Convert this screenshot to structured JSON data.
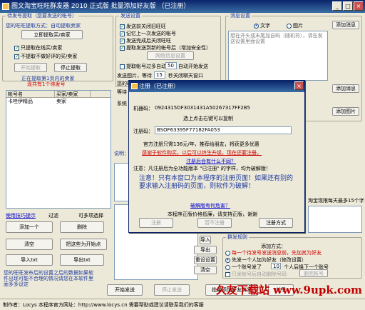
{
  "window": {
    "title": "图文淘宝旺旺群发器 2010 正式版 批量添加好友版 （已注册）",
    "minimize": "_",
    "maximize": "□",
    "close": "×"
  },
  "left_panel": {
    "group_title": "待发号提取（您要发送的帐号）",
    "hint": "您的旺旺提取方式：自动提取卖家",
    "btn_extract_now": "立即提取买/卖家",
    "chk_online_only": "只提取在线买/卖家",
    "chk_skip_sent": "不提取不做好评的买/卖家",
    "btn_start_extract": "开始提取",
    "btn_stop_extract": "停止提取",
    "status1": "正在提取第1页内的卖家",
    "status2": "现共有1个待发号",
    "table_headers": [
      "帐号名",
      "买家/卖家"
    ],
    "table_rows": [
      [
        "卡哇伊精品",
        "卖家"
      ]
    ],
    "link_tips": "使用技巧提示",
    "lbl_filter": "过滤",
    "lbl_select": "可多项选择",
    "btn_add_one": "添加一个",
    "btn_delete": "删除",
    "btn_clear": "清空",
    "btn_resend": "把这些为开始点",
    "btn_import": "导入txt",
    "btn_export": "导出txt",
    "note": "您的旺旺发布后的设置之后的数据如果软件出现可能不合理的情况请您在本软件里面多多设定"
  },
  "send_settings": {
    "group_title": "发送设置",
    "chk1": "发送前关闭旧旺旺",
    "chk2": "记忆上一次发送的帐号",
    "chk3": "发送完成后关闭旺旺",
    "chk4": "提取发送到新的帐号后（增加安全性）",
    "btn_network": "网络信息设置",
    "chk5": "提取帐号过多自动",
    "chk5_value": "50",
    "chk5_tail": "自动开始发送",
    "lbl_image": "发送图片，等待",
    "image_wait": "15",
    "image_tail": "秒关闭聊天窗口",
    "lbl_cut": "您的旺旺联系多少",
    "lbl_wait": "等待",
    "lbl_status": "系统",
    "lbl_desc": "说明："
  },
  "message_panel": {
    "group_title": "消息设置",
    "radio_text": "文字",
    "radio_image": "图片",
    "btn_add_msg": "添加消息",
    "placeholder": "想在开头或末尾加自码（随机符），请在发送设置里面设置",
    "btn_add_msg2": "添加消息",
    "btn_add_msg3": "添加图片",
    "lbl_limit": "淘宝现限每天最多15个字"
  },
  "mass_panel": {
    "btn_import": "导入",
    "btn_export": "导出",
    "btn_reset": "重设设置",
    "btn_clear": "清空",
    "group_title": "群发规则",
    "lbl_add_mode": "添加方式：",
    "opt1": "每一个待发号发送消息前，先加其为好友",
    "opt2": "先发一个人加为好友（修改设置）",
    "opt3": "一个账号发了",
    "opt3_value": "10",
    "opt3_tail": "个人后换下一个账号",
    "opt4": "只发帐号后自动删除号码",
    "btn_del_acc": "删完帐号"
  },
  "bottom_bar": {
    "btn_start": "开始发送",
    "btn_stop": "停止发送",
    "btn_batch": "批量添加好友群发",
    "btn_close": "关于"
  },
  "status_bar": {
    "text": "制作者：Locys    本程序官方网址：http://www.locys.cn  需要帮助或建议请联系我们的客服"
  },
  "watermark": "久友下载站 www.9upk.com",
  "modal": {
    "title": "注册（已注册）",
    "machine_label": "机器码：",
    "machine_code": "0924315DF3031431A50267317FF2B5",
    "copy_hint": "选上点击右键可以复制",
    "reg_label": "注册码：",
    "reg_code": "BSOF63395F77182FA053",
    "price_line": "官方注册只需136元/年，推荐给朋友，将获更多优惠",
    "red_line": "感谢于软件购买，以后可以终生升级，现在还要注册。",
    "link_line": "注册后会有什么不同？",
    "desc_line": "注意：凡注册后为全功能版本 \"已注册\" 的字样，均为破解版！",
    "big_warning": "注意！只有本窗口为本程序的注册页面！如果还有别的要求输入注册码的页面，则软件为破解！",
    "link_cracked": "破解版有何危害？",
    "footer_note": "本程序正版价格低廉，请支持正版，谢谢",
    "btn_register": "注册",
    "btn_trial": "暂不注册",
    "btn_reg_mode": "注册方式"
  }
}
